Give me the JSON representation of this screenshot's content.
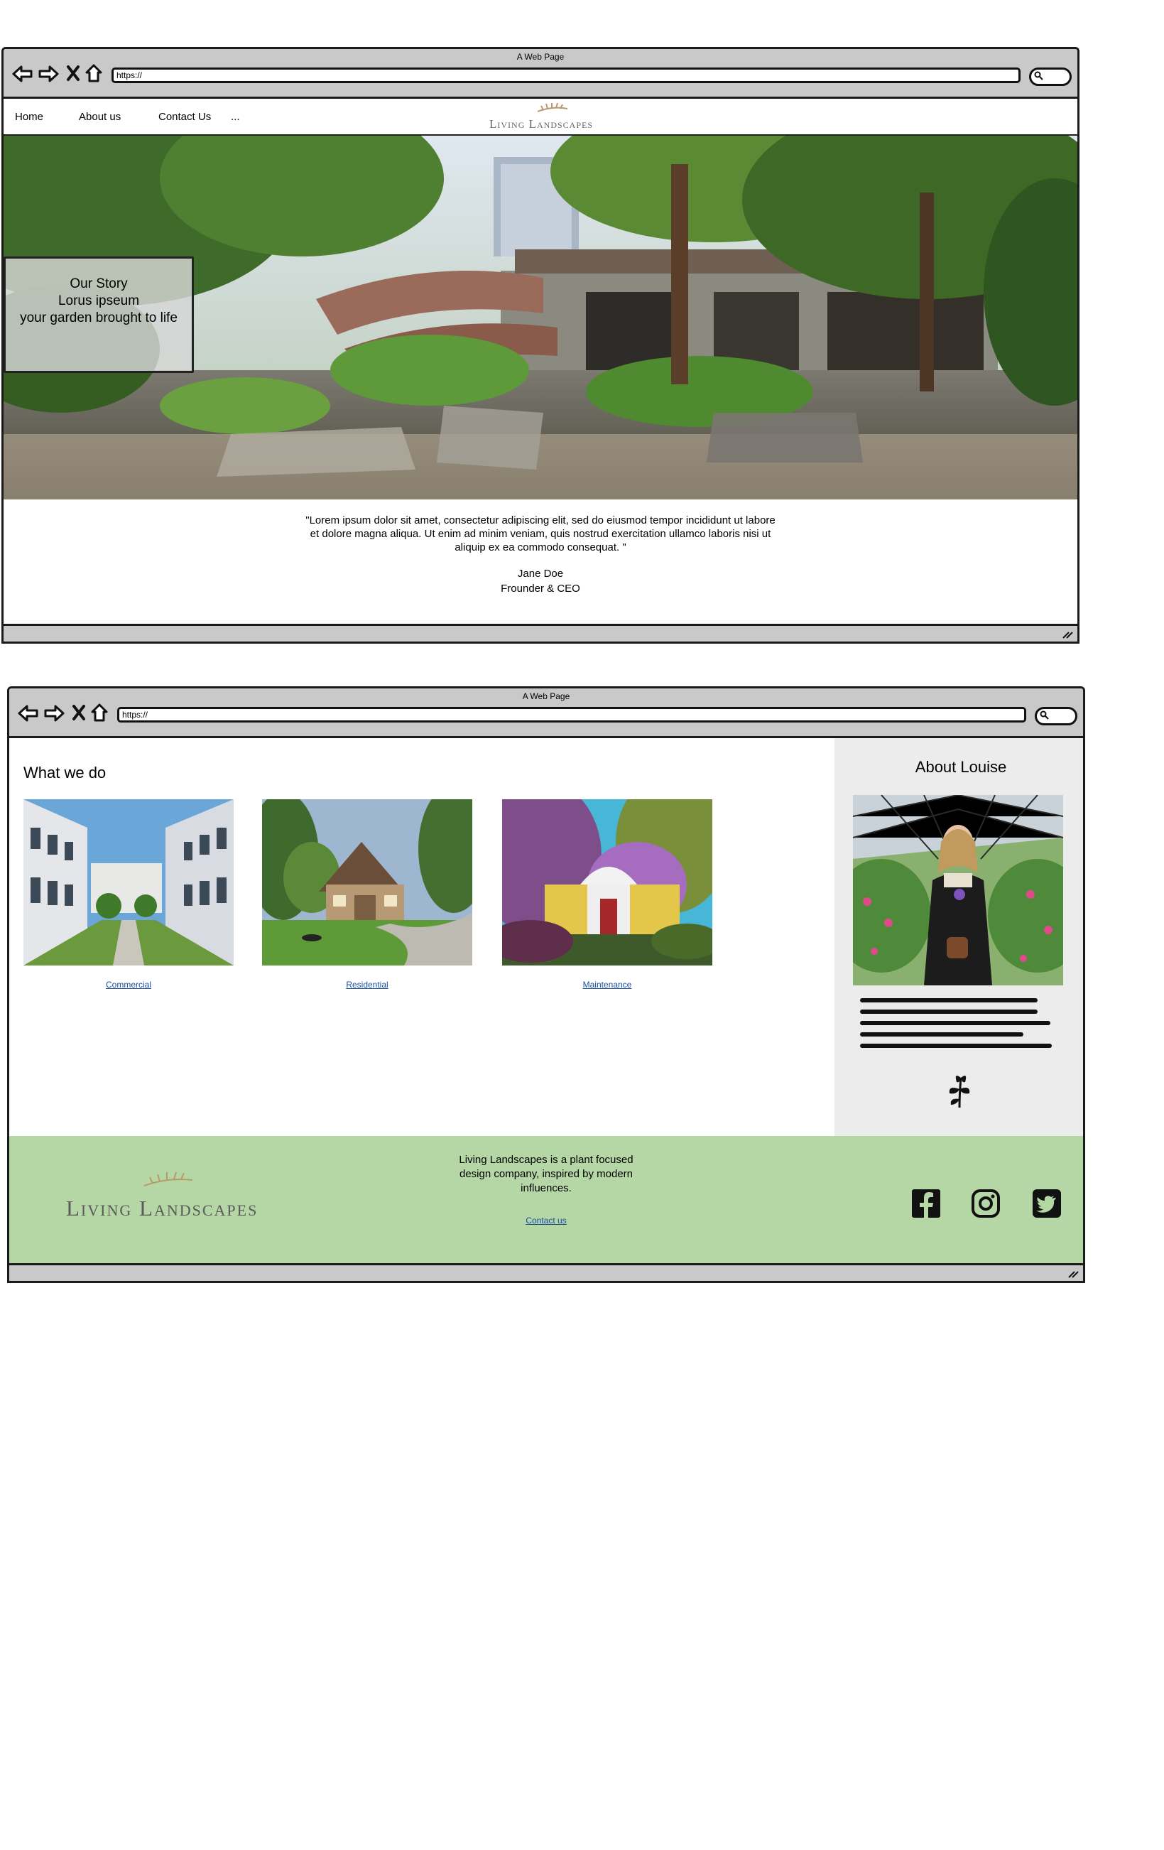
{
  "window1": {
    "title": "A Web Page",
    "url": "https://",
    "nav": {
      "home": "Home",
      "about": "About us",
      "contact": "Contact Us",
      "more": "..."
    },
    "brand": "Living Landscapes",
    "hero": {
      "line1": "Our Story",
      "line2": "Lorus ipseum",
      "line3": "your garden brought to life"
    },
    "quote": {
      "line1": "\"Lorem ipsum dolor sit amet, consectetur adipiscing elit, sed do eiusmod tempor incididunt ut labore",
      "line2": "et dolore magna aliqua. Ut enim ad minim veniam, quis nostrud exercitation ullamco laboris nisi ut",
      "line3": "aliquip ex ea commodo consequat. \"",
      "author": "Jane Doe",
      "role": "Frounder & CEO"
    }
  },
  "window2": {
    "title": "A Web Page",
    "url": "https://",
    "what_we_do": {
      "title": "What we do",
      "cards": [
        {
          "label": "Commercial"
        },
        {
          "label": "Residential"
        },
        {
          "label": "Maintenance"
        }
      ]
    },
    "about": {
      "title": "About Louise"
    },
    "footer": {
      "brand": "Living Landscapes",
      "desc_line1": "Living Landscapes is a plant focused",
      "desc_line2": "design company, inspired by modern",
      "desc_line3": "influences.",
      "contact": "Contact us",
      "social": [
        "facebook-icon",
        "instagram-icon",
        "twitter-icon"
      ]
    }
  },
  "colors": {
    "chrome": "#c9c9c9",
    "footer_green": "#b5d6a5",
    "sidebar_gray": "#ececec",
    "link_blue": "#1a4fa0"
  }
}
